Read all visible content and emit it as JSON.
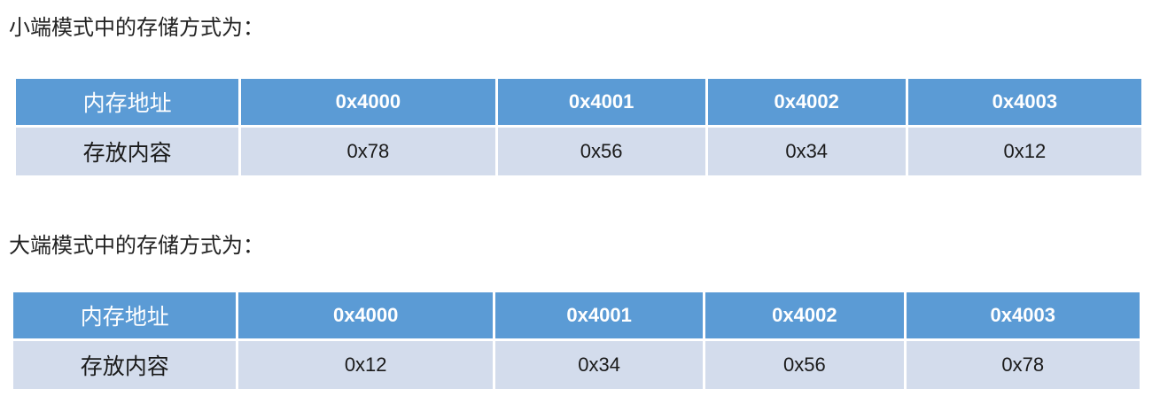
{
  "sections": [
    {
      "caption": "小端模式中的存储方式为：",
      "header": [
        "内存地址",
        "0x4000",
        "0x4001",
        "0x4002",
        "0x4003"
      ],
      "row": [
        "存放内容",
        "0x78",
        "0x56",
        "0x34",
        "0x12"
      ]
    },
    {
      "caption": "大端模式中的存储方式为：",
      "header": [
        "内存地址",
        "0x4000",
        "0x4001",
        "0x4002",
        "0x4003"
      ],
      "row": [
        "存放内容",
        "0x12",
        "0x34",
        "0x56",
        "0x78"
      ]
    }
  ],
  "colors": {
    "header_bg": "#5b9bd5",
    "row_bg": "#d3dcec",
    "header_text": "#ffffff",
    "body_text": "#1a1a1a"
  }
}
